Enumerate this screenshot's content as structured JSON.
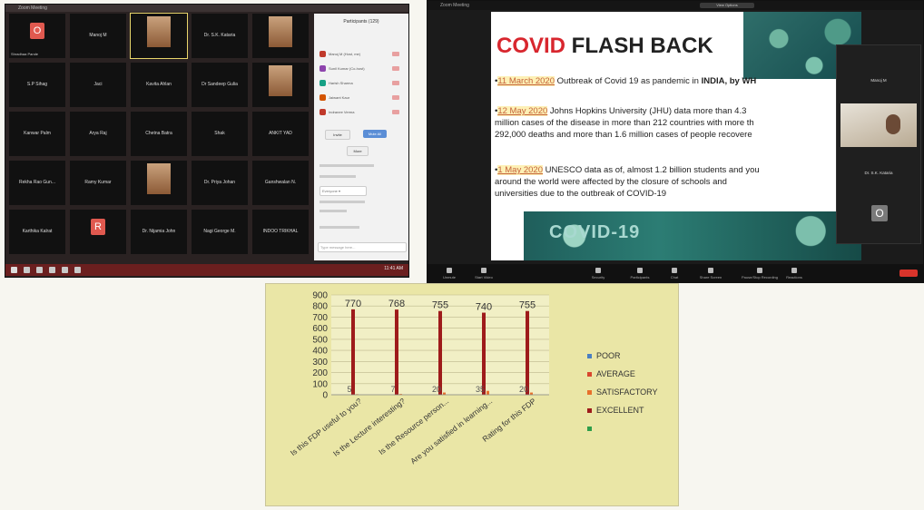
{
  "gallery": {
    "title": "Zoom Meeting",
    "tiles": [
      {
        "name": "Shradhaa Pande",
        "initial": "O",
        "color": "#e0594f"
      },
      {
        "name": "Manoj M",
        "initial": "",
        "color": ""
      },
      {
        "name": "",
        "initial": "",
        "color": "",
        "photo": true,
        "active": true
      },
      {
        "name": "Dr. S.K. Kataria",
        "initial": "",
        "color": ""
      },
      {
        "name": "",
        "initial": "",
        "color": "",
        "photo": true
      },
      {
        "name": "S.P Sihag",
        "initial": "",
        "color": ""
      },
      {
        "name": "Jaci",
        "initial": "",
        "color": ""
      },
      {
        "name": "Kavita Ahlan",
        "initial": "",
        "color": ""
      },
      {
        "name": "Dr Sandeep Gulia",
        "initial": "",
        "color": ""
      },
      {
        "name": "",
        "initial": "",
        "color": "",
        "photo": true
      },
      {
        "name": "Kanwar Palm",
        "initial": "",
        "color": ""
      },
      {
        "name": "Arya Raj",
        "initial": "",
        "color": ""
      },
      {
        "name": "Chetna Batra",
        "initial": "",
        "color": ""
      },
      {
        "name": "Shak",
        "initial": "",
        "color": ""
      },
      {
        "name": "ANKIT YAD",
        "initial": "",
        "color": ""
      },
      {
        "name": "Rekha Rao Gun...",
        "initial": "",
        "color": ""
      },
      {
        "name": "Ramy Kumar",
        "initial": "",
        "color": ""
      },
      {
        "name": "",
        "initial": "",
        "color": "",
        "photo": true
      },
      {
        "name": "Dr. Priya Johan",
        "initial": "",
        "color": ""
      },
      {
        "name": "Ganshwalan N.",
        "initial": "",
        "color": ""
      },
      {
        "name": "Karthika Kalrat",
        "initial": "",
        "color": ""
      },
      {
        "name": "",
        "initial": "R",
        "color": "#e0594f"
      },
      {
        "name": "Dr. Nijamia John",
        "initial": "",
        "color": ""
      },
      {
        "name": "Nagi George M.",
        "initial": "",
        "color": ""
      },
      {
        "name": "INDOO TRIKHAL",
        "initial": "",
        "color": ""
      }
    ],
    "panel_title": "Participants (129)",
    "participants": [
      {
        "name": "Manoj M (Host, me)",
        "color": "#c0392b"
      },
      {
        "name": "Sunil Kumar (Co-host)",
        "color": "#8e44ad"
      },
      {
        "name": "Harish Sharma",
        "color": "#16a085"
      },
      {
        "name": "Jaiwant Kaur",
        "color": "#d35400"
      },
      {
        "name": "Indranee Verma",
        "color": "#c0392b"
      }
    ],
    "panel_buttons": [
      "Invite",
      "Mute All"
    ],
    "panel_more": "More",
    "chat_placeholder": "Type message here...",
    "clock": "11:41 AM"
  },
  "share": {
    "top_title": "Zoom Meeting",
    "viewing_tag": "View Options",
    "slide": {
      "title_red": "COVID",
      "title_dark": " FLASH BACK",
      "b1_date": "11 March 2020",
      "b1_text": " Outbreak of Covid 19 as pandemic  in ",
      "b1_bold": "INDIA, by WH",
      "b2_date": "12 May 2020",
      "b2_text": "  Johns Hopkins University (JHU) data more than 4.3",
      "b2_line2": "million cases of the disease in more than 212 countries with more th",
      "b2_line3": "292,000 deaths and more than 1.6 million cases of people recovere",
      "b3_date": "1 May 2020",
      "b3_text": " UNESCO data as of, almost 1.2 billion students and you",
      "b3_line2": "around the world were affected by the closure of schools and",
      "b3_line3": "universities due to the outbreak of COVID-19",
      "bottom_text": "COVID-19"
    },
    "video_names": [
      "Manoj M",
      "Dr. S.K. Kataria",
      ""
    ],
    "video_initial": "O",
    "toolbar": [
      "Unmute",
      "Start Video",
      "Security",
      "Participants",
      "Chat",
      "Share Screen",
      "Pause/Stop Recording",
      "Reactions"
    ]
  },
  "chart_data": {
    "type": "bar",
    "categories": [
      "Is this FDP useful to you?",
      "Is the Lecture interesting?",
      "Is the Resource person...",
      "Are you satisfied in learning...",
      "Rating for this FDP"
    ],
    "series": [
      {
        "name": "POOR",
        "values": [
          0,
          0,
          0,
          0,
          0
        ],
        "color": "#4a7fc1"
      },
      {
        "name": "AVERAGE",
        "values": [
          0,
          0,
          0,
          0,
          0
        ],
        "color": "#d8472e"
      },
      {
        "name": "SATISFACTORY",
        "values": [
          5,
          7,
          20,
          35,
          20
        ],
        "color": "#e8702b"
      },
      {
        "name": "EXCELLENT",
        "values": [
          770,
          768,
          755,
          740,
          755
        ],
        "color": "#9e1b1b"
      },
      {
        "name": "",
        "values": [
          0,
          0,
          0,
          0,
          0
        ],
        "color": "#2e9e4a"
      }
    ],
    "data_labels": [
      "770",
      "768",
      "755",
      "740",
      "755"
    ],
    "small_labels": [
      "5",
      "7",
      "20",
      "35",
      "20"
    ],
    "ylim": [
      0,
      900
    ],
    "yticks": [
      0,
      100,
      200,
      300,
      400,
      500,
      600,
      700,
      800,
      900
    ],
    "legend": "right",
    "grid": true
  }
}
